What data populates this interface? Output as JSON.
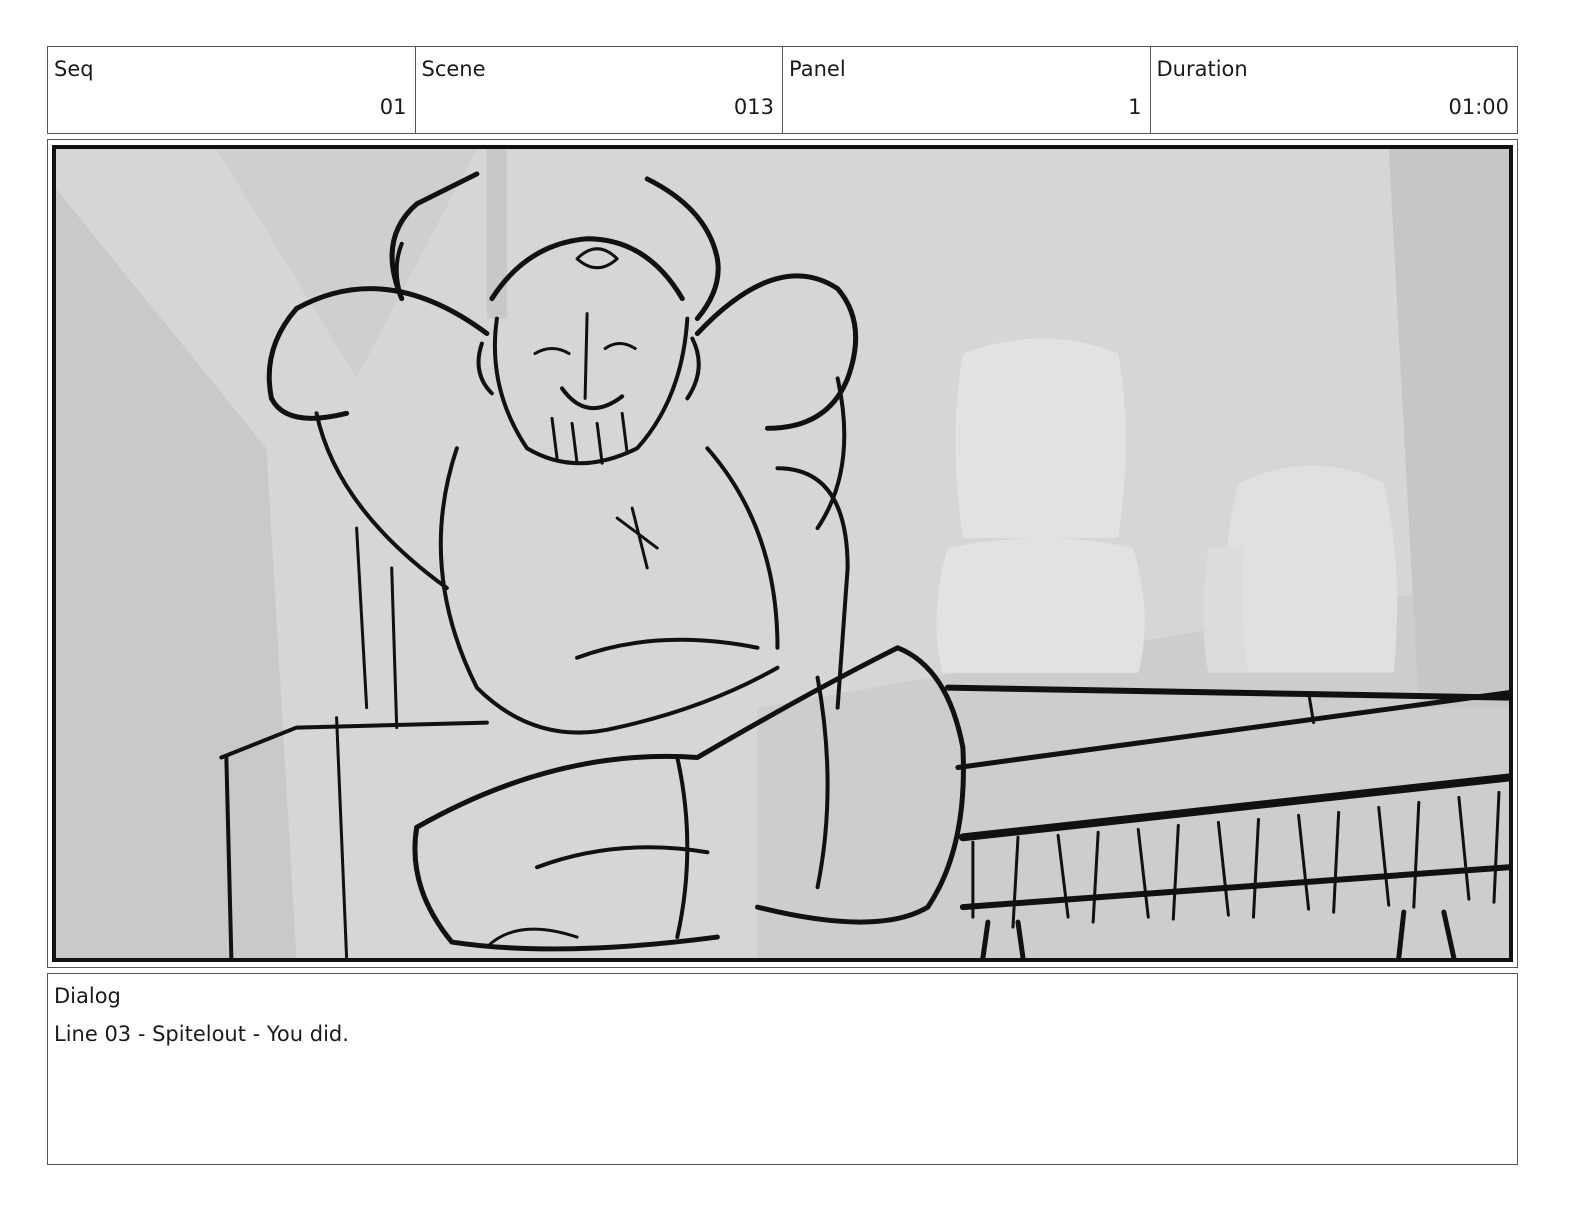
{
  "header": {
    "fields": [
      {
        "label": "Seq",
        "value": "01"
      },
      {
        "label": "Scene",
        "value": "013"
      },
      {
        "label": "Panel",
        "value": "1"
      },
      {
        "label": "Duration",
        "value": "01:00"
      }
    ]
  },
  "dialog": {
    "label": "Dialog",
    "line": "Line 03 - Spitelout - You did."
  }
}
